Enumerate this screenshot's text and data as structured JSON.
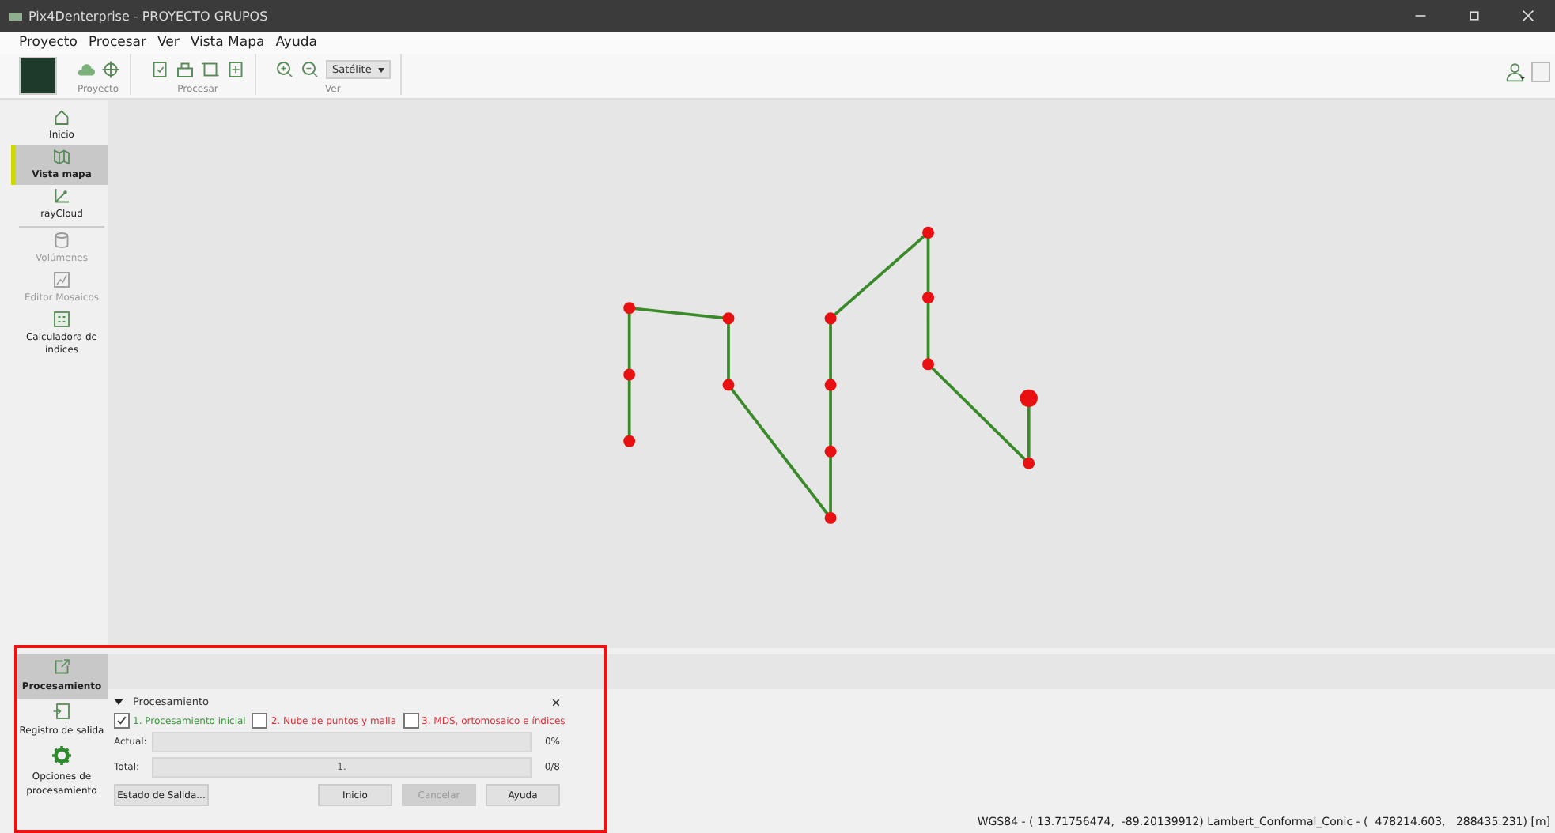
{
  "window": {
    "title": "Pix4Denterprise - PROYECTO GRUPOS"
  },
  "menu": [
    "Proyecto",
    "Procesar",
    "Ver",
    "Vista Mapa",
    "Ayuda"
  ],
  "toolbar": {
    "groups": [
      {
        "label": "Proyecto"
      },
      {
        "label": "Procesar"
      },
      {
        "label": "Ver",
        "dropdown": "Satélite"
      }
    ]
  },
  "sidebar": {
    "items": [
      {
        "label": "Inicio",
        "selected": false,
        "disabled": false
      },
      {
        "label": "Vista mapa",
        "selected": true,
        "disabled": false
      },
      {
        "label": "rayCloud",
        "selected": false,
        "disabled": false
      },
      {
        "label": "Volúmenes",
        "selected": false,
        "disabled": true
      },
      {
        "label": "Editor Mosaicos",
        "selected": false,
        "disabled": true
      },
      {
        "label": "Calculadora de índices",
        "selected": false,
        "disabled": false
      }
    ]
  },
  "bottom_sidebar": {
    "items": [
      {
        "label": "Procesamiento",
        "selected": true
      },
      {
        "label": "Registro de salida",
        "selected": false
      },
      {
        "label": "Opciones de procesamiento",
        "selected": false
      }
    ]
  },
  "panel": {
    "title": "Procesamiento",
    "expanded": true,
    "steps": [
      {
        "label": "1. Procesamiento inicial",
        "checked": true,
        "color": "#3a9a3a"
      },
      {
        "label": "2. Nube de puntos y malla",
        "checked": false,
        "color": "#e0303a"
      },
      {
        "label": "3. MDS, ortomosaico e índices",
        "checked": false,
        "color": "#e0303a"
      }
    ],
    "progress": [
      {
        "label": "Actual:",
        "level": 0,
        "reading": "0%"
      },
      {
        "label": "Total:",
        "level": 0,
        "text": "1.",
        "reading": "0/8"
      }
    ],
    "status_button": "Estado de Salida...",
    "buttons": [
      {
        "label": "Inicio",
        "disabled": false
      },
      {
        "label": "Cancelar",
        "disabled": true
      },
      {
        "label": "Ayuda",
        "disabled": false
      }
    ]
  },
  "status_bar": "WGS84 - ( 13.71756474,  -89.20139912) Lambert_Conformal_Conic - (  478214.603,   288435.231) [m]"
}
